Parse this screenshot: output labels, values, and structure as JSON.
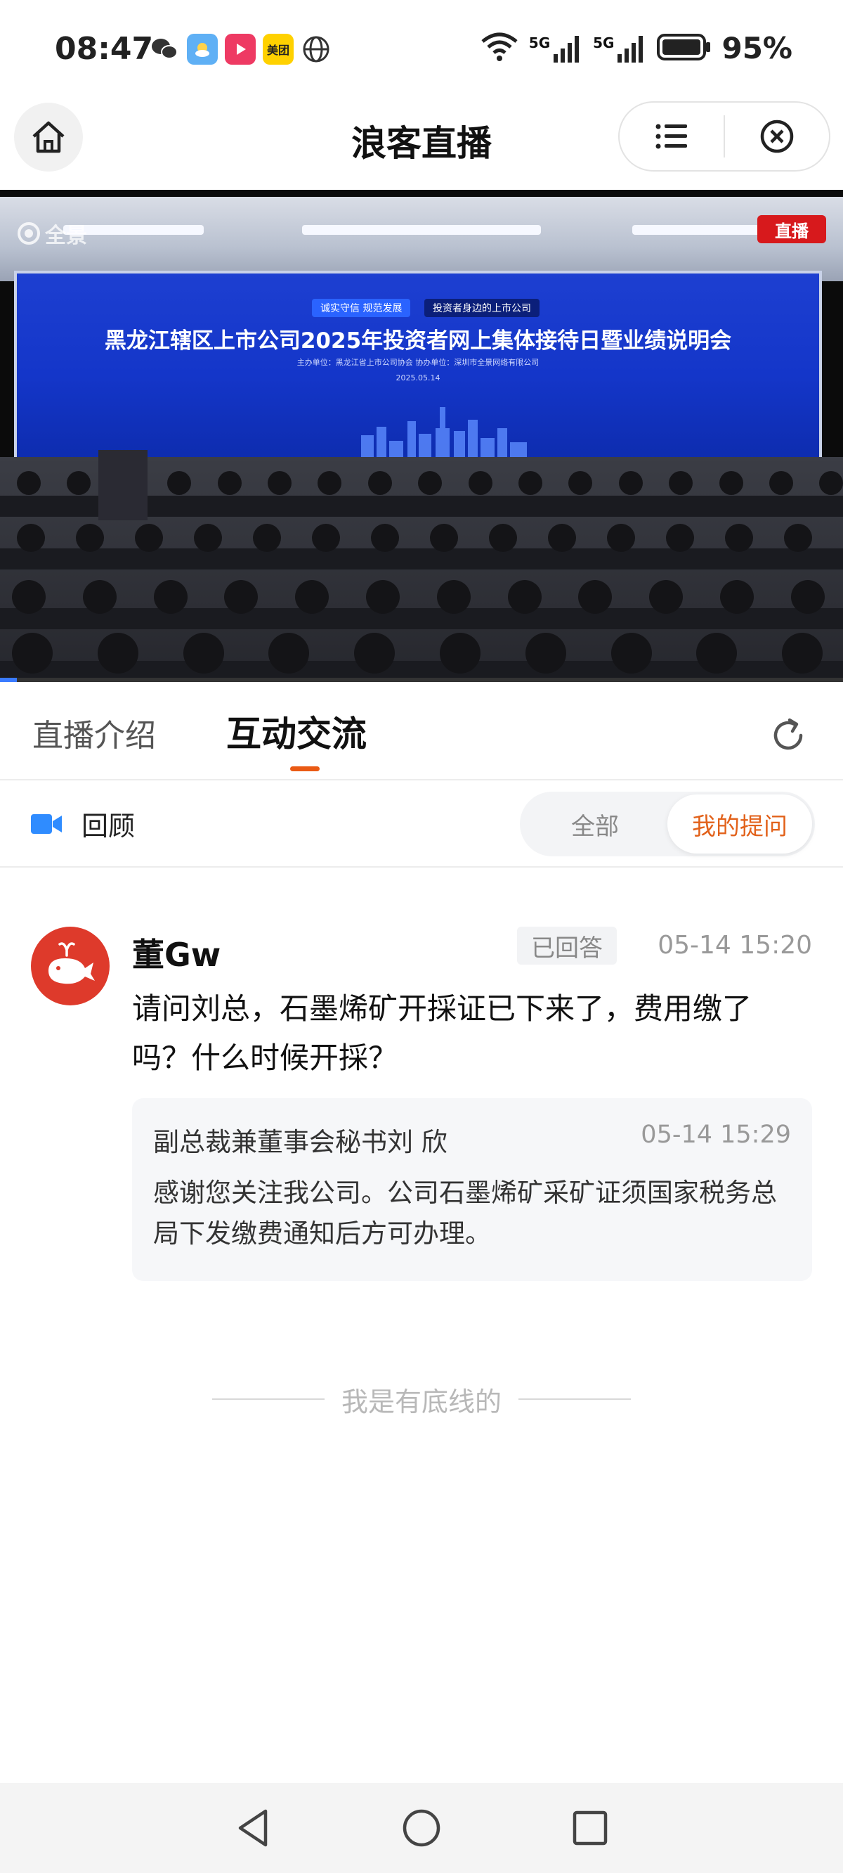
{
  "status_bar": {
    "time": "08:47",
    "apps": [
      "wechat-icon",
      "weather-icon",
      "video-icon",
      "美团",
      "globe-icon"
    ],
    "battery_pct": "95%",
    "signal_labels": [
      "5G",
      "5G"
    ]
  },
  "nav": {
    "title": "浪客直播"
  },
  "video": {
    "brand": "全景",
    "live_badge": "直播",
    "screen_title": "黑龙江辖区上市公司2025年投资者网上集体接待日暨业绩说明会",
    "screen_tags": [
      "诚实守信  规范发展",
      "投资者身边的上市公司"
    ],
    "screen_sub": "主办单位：黑龙江省上市公司协会     协办单位：深圳市全景网络有限公司",
    "screen_date": "2025.05.14",
    "progress": 0.02
  },
  "tabs": {
    "items": [
      "直播介绍",
      "互动交流"
    ],
    "active_index": 1
  },
  "filter": {
    "replay_label": "回顾",
    "segments": [
      "全部",
      "我的提问"
    ],
    "active_segment": 1
  },
  "comment": {
    "user": "董Gw",
    "badge": "已回答",
    "time": "05-14 15:20",
    "question": "请问刘总，石墨烯矿开採证已下来了，费用缴了吗？什么时候开採？",
    "reply": {
      "author": "副总裁兼董事会秘书刘 欣",
      "time": "05-14 15:29",
      "text": "感谢您关注我公司。公司石墨烯矿采矿证须国家税务总局下发缴费通知后方可办理。"
    }
  },
  "footer_text": "我是有底线的",
  "colors": {
    "accent": "#ea5a14",
    "live_red": "#d7191c",
    "avatar_red": "#de3a2b",
    "screen_blue": "#1436c9"
  }
}
